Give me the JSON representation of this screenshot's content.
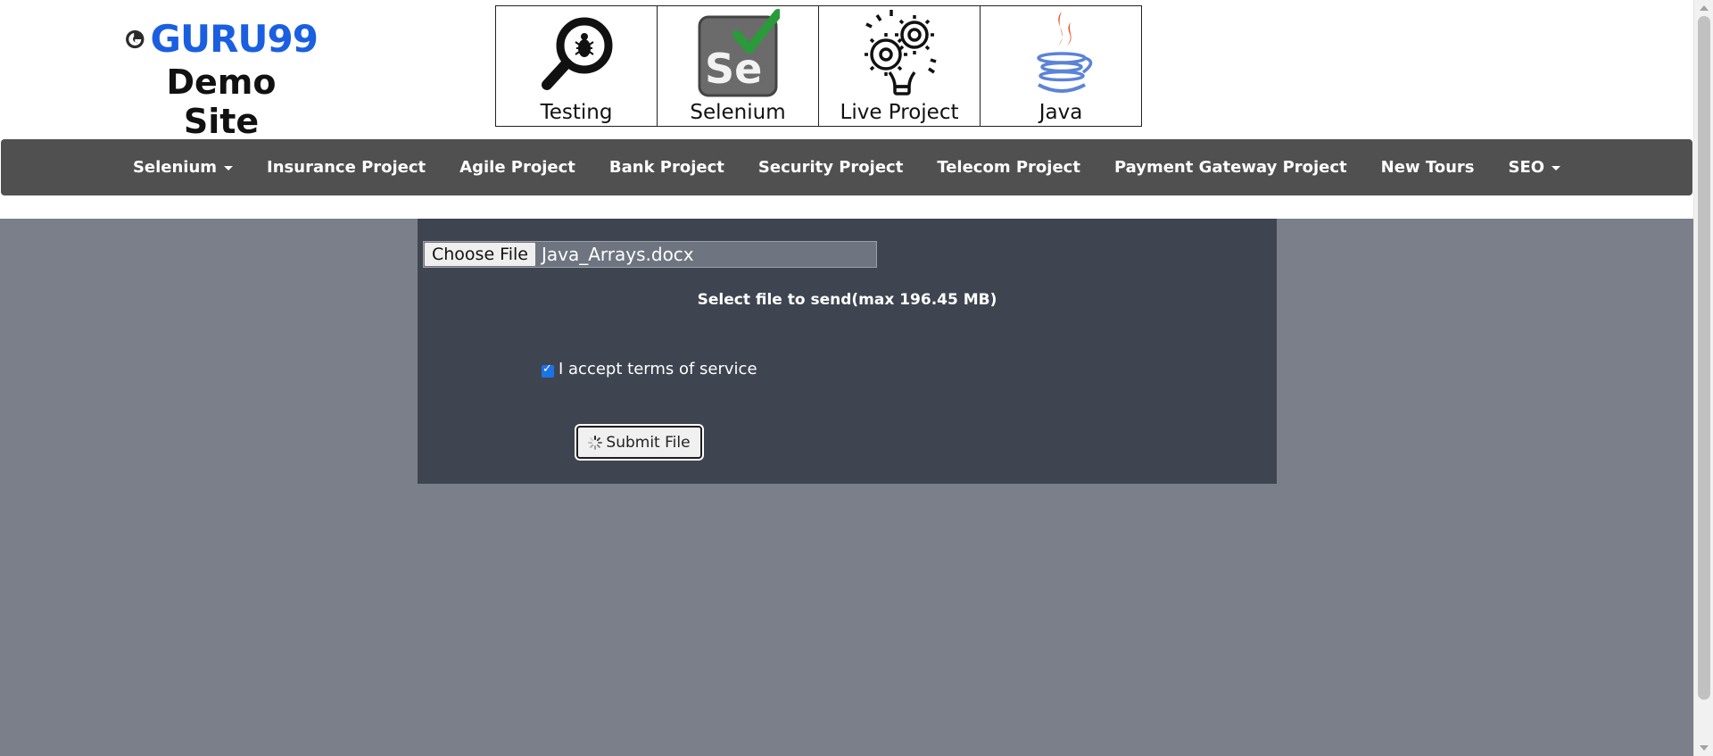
{
  "header": {
    "logo_text": "GURU99",
    "site_subtitle": "Demo Site",
    "tiles": [
      {
        "label": "Testing",
        "icon": "magnifier-bug-icon"
      },
      {
        "label": "Selenium",
        "icon": "selenium-check-icon"
      },
      {
        "label": "Live Project",
        "icon": "gear-bulb-icon"
      },
      {
        "label": "Java",
        "icon": "java-coffee-icon"
      }
    ]
  },
  "nav": {
    "items": [
      {
        "label": "Selenium",
        "dropdown": true
      },
      {
        "label": "Insurance Project"
      },
      {
        "label": "Agile Project"
      },
      {
        "label": "Bank Project"
      },
      {
        "label": "Security Project"
      },
      {
        "label": "Telecom Project"
      },
      {
        "label": "Payment Gateway Project"
      },
      {
        "label": "New Tours"
      },
      {
        "label": "SEO",
        "dropdown": true
      }
    ]
  },
  "upload": {
    "choose_label": "Choose File",
    "file_name": "Java_Arrays.docx",
    "hint": "Select file to send(max 196.45 MB)",
    "terms_label": "I accept terms of service",
    "terms_checked": true,
    "submit_label": "Submit File"
  },
  "colors": {
    "logo_blue": "#1a5fe0",
    "nav_bg": "#505050",
    "panel_bg": "#3e4550",
    "page_bg": "#7b7f89",
    "checkbox_accent": "#1a73e8"
  }
}
